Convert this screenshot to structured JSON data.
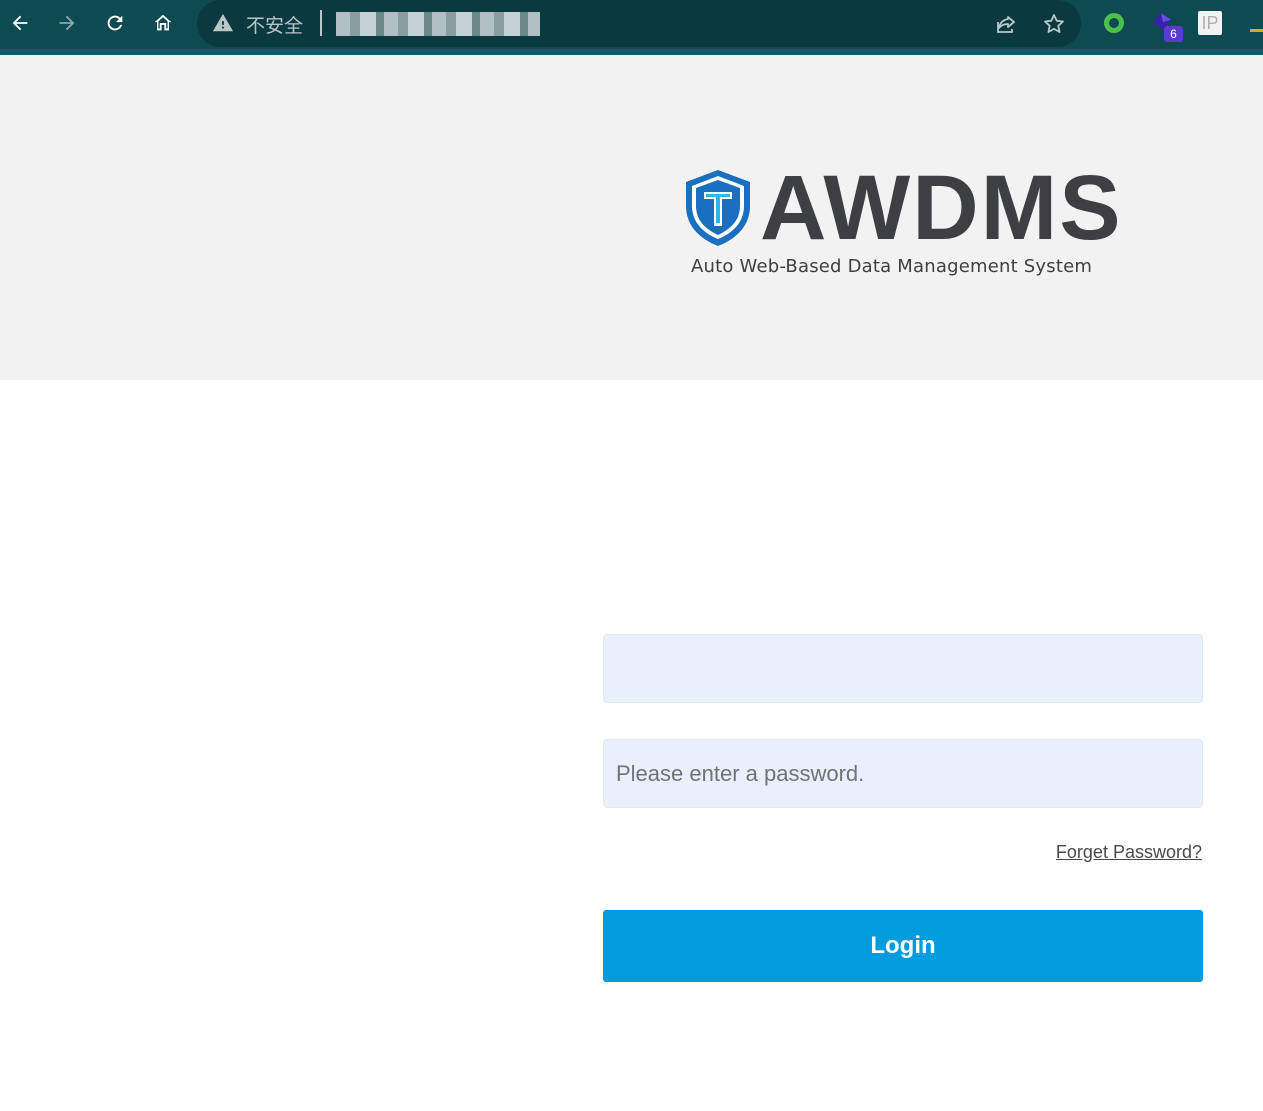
{
  "browser": {
    "security_label": "不安全",
    "url": "",
    "extension_badge": "6",
    "ip_extension_label": "IP"
  },
  "brand": {
    "name": "AWDMS",
    "tagline": "Auto Web-Based Data Management System",
    "shield_letter": "T",
    "colors": {
      "text": "#3d3f42",
      "shield_blue": "#1a6fc0",
      "shield_light": "#2bb7e8"
    }
  },
  "login_form": {
    "username": {
      "value": "",
      "placeholder": ""
    },
    "password": {
      "value": "",
      "placeholder": "Please enter a password."
    },
    "forget_password_label": "Forget Password?",
    "login_label": "Login",
    "accent_color": "#009cdd"
  },
  "icons": [
    "back-icon",
    "forward-icon",
    "reload-icon",
    "home-icon",
    "warning-icon",
    "share-icon",
    "star-icon",
    "extension-icon",
    "ip-icon"
  ]
}
